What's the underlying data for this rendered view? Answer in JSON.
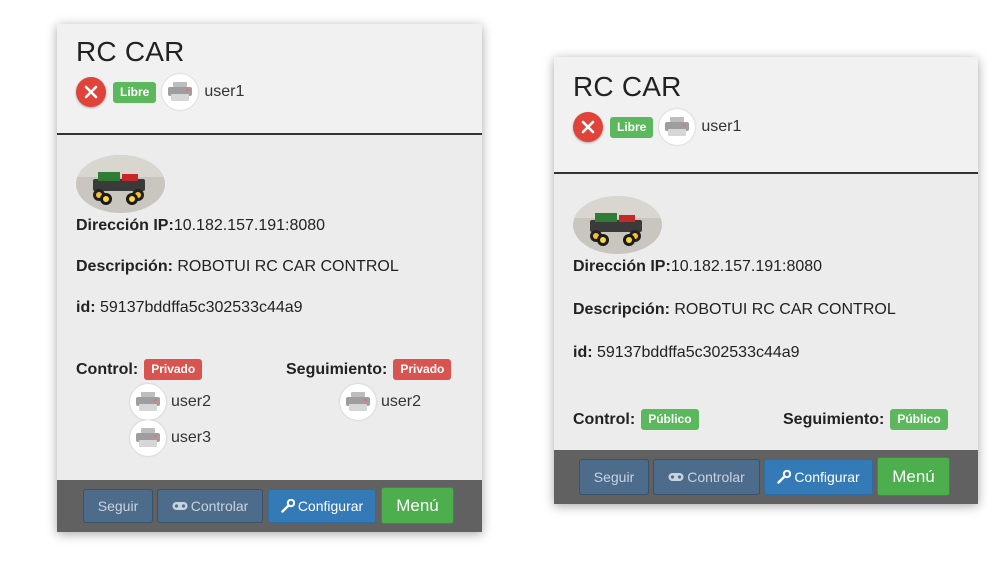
{
  "cards": [
    {
      "title": "RC CAR",
      "status_badge": "Libre",
      "owner": "user1",
      "ip_label": "Dirección IP:",
      "ip_value": "10.182.157.191:8080",
      "desc_label": "Descripción:",
      "desc_value": "ROBOTUI RC CAR CONTROL",
      "id_label": "id:",
      "id_value": "59137bddffa5c302533c44a9",
      "control_label": "Control:",
      "control_badge": "Privado",
      "control_users": [
        "user2",
        "user3"
      ],
      "tracking_label": "Seguimiento:",
      "tracking_badge": "Privado",
      "tracking_users": [
        "user2"
      ],
      "buttons": {
        "follow": "Seguir",
        "control": "Controlar",
        "configure": "Configurar",
        "menu": "Menú"
      }
    },
    {
      "title": "RC CAR",
      "status_badge": "Libre",
      "owner": "user1",
      "ip_label": "Dirección IP:",
      "ip_value": "10.182.157.191:8080",
      "desc_label": "Descripción:",
      "desc_value": "ROBOTUI RC CAR CONTROL",
      "id_label": "id:",
      "id_value": "59137bddffa5c302533c44a9",
      "control_label": "Control:",
      "control_badge": "Público",
      "tracking_label": "Seguimiento:",
      "tracking_badge": "Público",
      "buttons": {
        "follow": "Seguir",
        "control": "Controlar",
        "configure": "Configurar",
        "menu": "Menú"
      }
    }
  ],
  "colors": {
    "danger": "#e0433a",
    "badge_green": "#5cb85c",
    "badge_red": "#d9534f",
    "footer": "#616161",
    "primary": "#337ab7",
    "success": "#4cae4c"
  },
  "icons": [
    "close-icon",
    "user-avatar-icon",
    "gamepad-icon",
    "wrench-icon"
  ]
}
